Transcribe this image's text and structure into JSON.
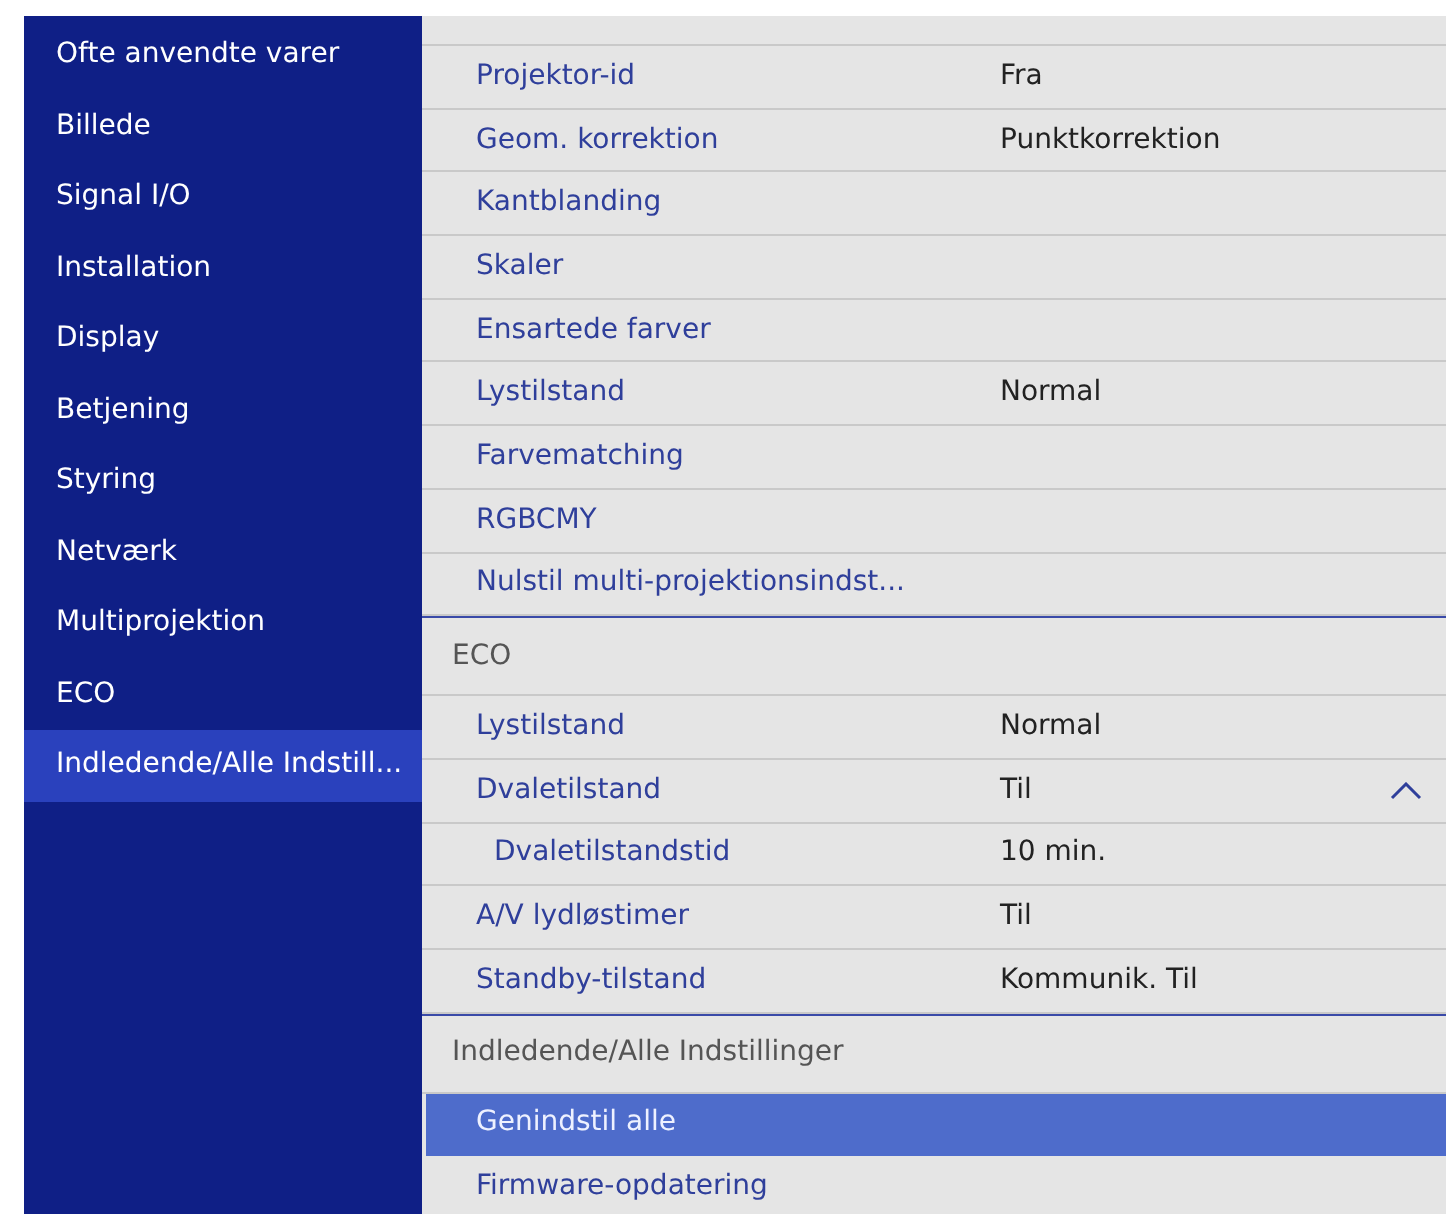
{
  "sidebar": {
    "items": [
      {
        "label": "Ofte anvendte varer",
        "selected": false
      },
      {
        "label": "Billede",
        "selected": false
      },
      {
        "label": "Signal I/O",
        "selected": false
      },
      {
        "label": "Installation",
        "selected": false
      },
      {
        "label": "Display",
        "selected": false
      },
      {
        "label": "Betjening",
        "selected": false
      },
      {
        "label": "Styring",
        "selected": false
      },
      {
        "label": "Netværk",
        "selected": false
      },
      {
        "label": "Multiprojektion",
        "selected": false
      },
      {
        "label": "ECO",
        "selected": false
      },
      {
        "label": "Indledende/Alle Indstill...",
        "selected": true
      }
    ]
  },
  "sections": [
    {
      "items": [
        {
          "label": "Projektor-id",
          "value": "Fra",
          "selected": false
        },
        {
          "label": "Geom. korrektion",
          "value": "Punktkorrektion",
          "selected": false
        },
        {
          "label": "Kantblanding",
          "selected": false
        },
        {
          "label": "Skaler",
          "selected": false
        },
        {
          "label": "Ensartede farver",
          "selected": false
        },
        {
          "label": "Lystilstand",
          "value": "Normal",
          "selected": false
        },
        {
          "label": "Farvematching",
          "selected": false
        },
        {
          "label": "RGBCMY",
          "selected": false
        },
        {
          "label": "Nulstil multi-projektionsindst...",
          "selected": false
        }
      ]
    },
    {
      "header": "ECO",
      "items": [
        {
          "label": "Lystilstand",
          "value": "Normal",
          "selected": false
        },
        {
          "label": "Dvaletilstand",
          "value": "Til",
          "selected": false,
          "expanded": true,
          "children": [
            {
              "label": "Dvaletilstandstid",
              "value": "10 min.",
              "selected": false
            }
          ]
        },
        {
          "label": "A/V lydløstimer",
          "value": "Til",
          "selected": false
        },
        {
          "label": "Standby-tilstand",
          "value": "Kommunik. Til",
          "selected": false
        }
      ]
    },
    {
      "header": "Indledende/Alle Indstillinger",
      "items": [
        {
          "label": "Genindstil alle",
          "selected": true
        },
        {
          "label": "Firmware-opdatering",
          "selected": false
        }
      ]
    }
  ]
}
